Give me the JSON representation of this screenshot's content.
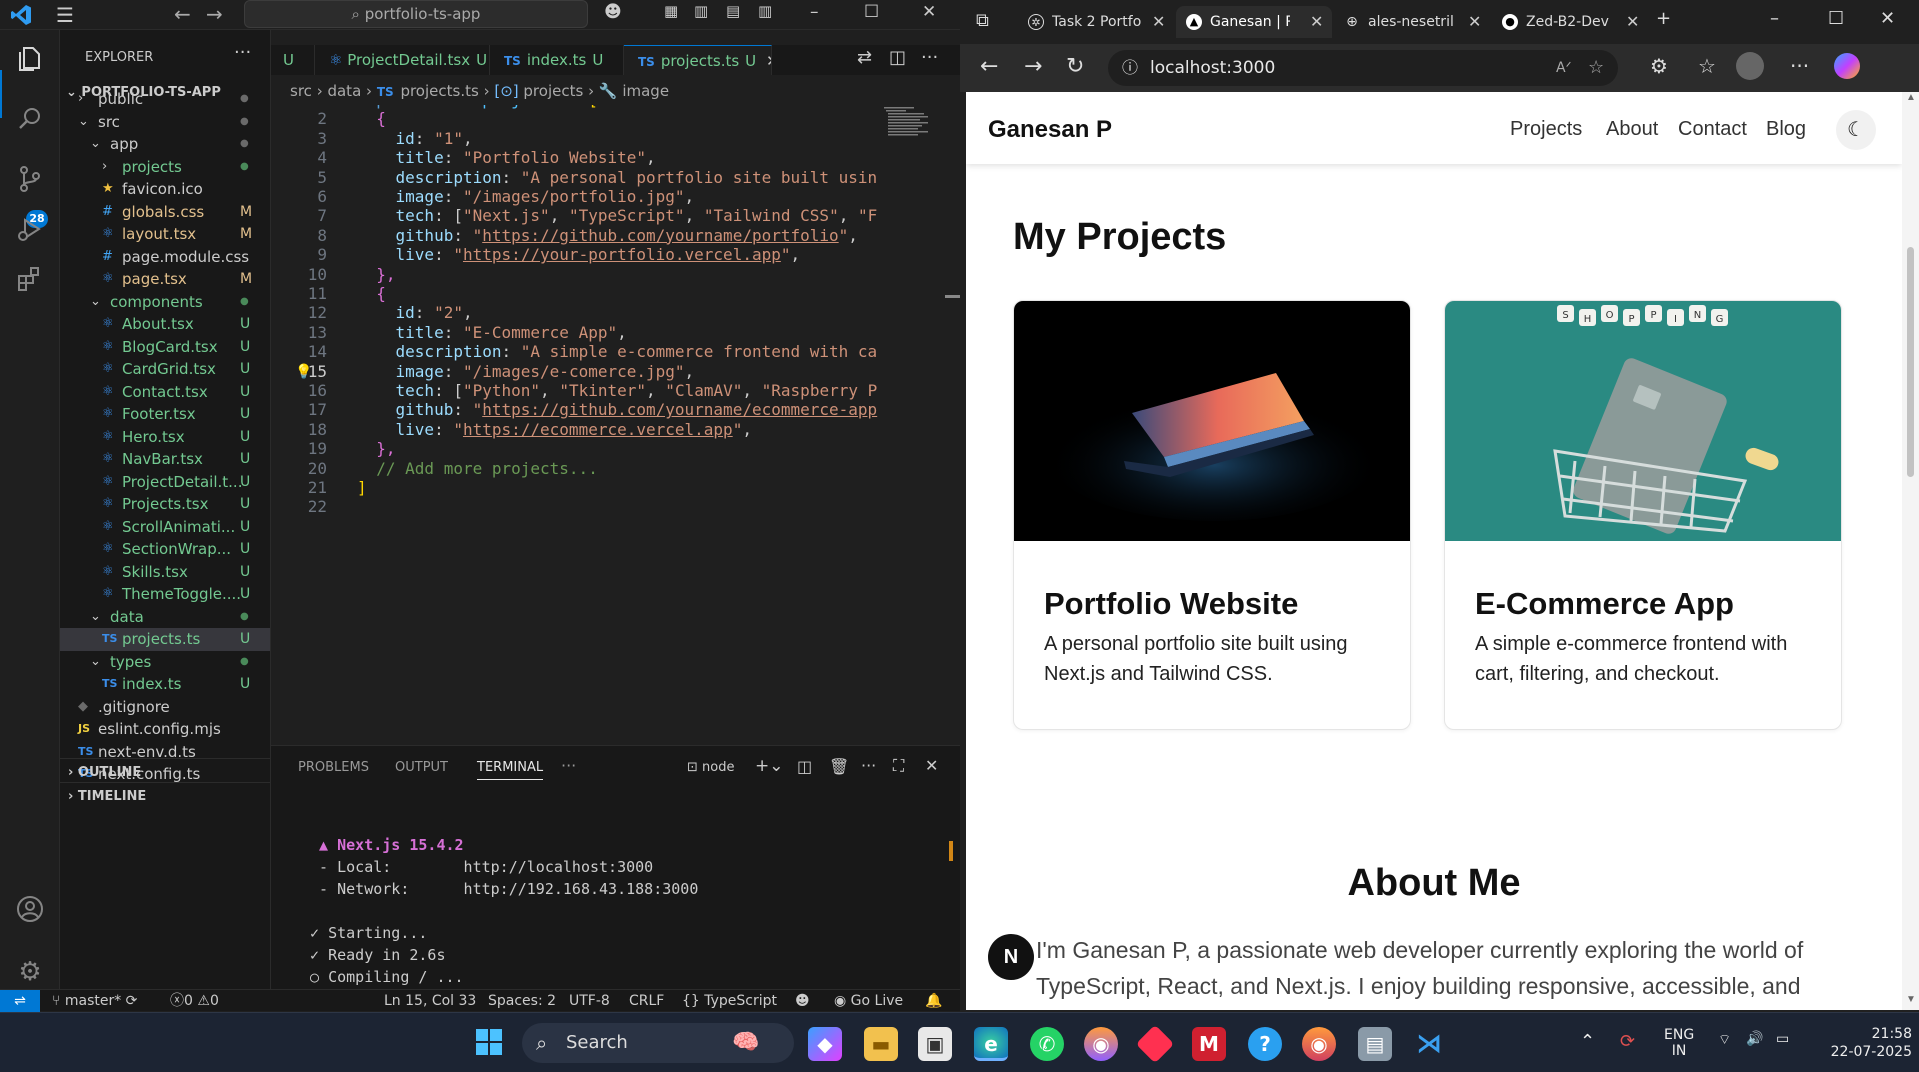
{
  "vscode": {
    "search_text": "portfolio-ts-app",
    "activity_badge": "28",
    "explorer": {
      "header": "EXPLORER",
      "project": "PORTFOLIO-TS-APP",
      "items": [
        {
          "name": "public",
          "depth": 1,
          "kind": "folder-closed",
          "status": "dot"
        },
        {
          "name": "src",
          "depth": 1,
          "kind": "folder-open",
          "status": "dot"
        },
        {
          "name": "app",
          "depth": 2,
          "kind": "folder-open",
          "status": "dot"
        },
        {
          "name": "projects",
          "depth": 3,
          "kind": "folder-closed",
          "status": "dot",
          "color": "untracked"
        },
        {
          "name": "favicon.ico",
          "depth": 3,
          "kind": "star",
          "status": ""
        },
        {
          "name": "globals.css",
          "depth": 3,
          "kind": "css",
          "status": "M",
          "color": "mod"
        },
        {
          "name": "layout.tsx",
          "depth": 3,
          "kind": "tsx",
          "status": "M",
          "color": "mod"
        },
        {
          "name": "page.module.css",
          "depth": 3,
          "kind": "css",
          "status": ""
        },
        {
          "name": "page.tsx",
          "depth": 3,
          "kind": "tsx",
          "status": "M",
          "color": "mod"
        },
        {
          "name": "components",
          "depth": 2,
          "kind": "folder-open",
          "status": "dot",
          "color": "untracked"
        },
        {
          "name": "About.tsx",
          "depth": 3,
          "kind": "tsx",
          "status": "U",
          "color": "untracked"
        },
        {
          "name": "BlogCard.tsx",
          "depth": 3,
          "kind": "tsx",
          "status": "U",
          "color": "untracked"
        },
        {
          "name": "CardGrid.tsx",
          "depth": 3,
          "kind": "tsx",
          "status": "U",
          "color": "untracked"
        },
        {
          "name": "Contact.tsx",
          "depth": 3,
          "kind": "tsx",
          "status": "U",
          "color": "untracked"
        },
        {
          "name": "Footer.tsx",
          "depth": 3,
          "kind": "tsx",
          "status": "U",
          "color": "untracked"
        },
        {
          "name": "Hero.tsx",
          "depth": 3,
          "kind": "tsx",
          "status": "U",
          "color": "untracked"
        },
        {
          "name": "NavBar.tsx",
          "depth": 3,
          "kind": "tsx",
          "status": "U",
          "color": "untracked"
        },
        {
          "name": "ProjectDetail.t...",
          "depth": 3,
          "kind": "tsx",
          "status": "U",
          "color": "untracked"
        },
        {
          "name": "Projects.tsx",
          "depth": 3,
          "kind": "tsx",
          "status": "U",
          "color": "untracked"
        },
        {
          "name": "ScrollAnimati...",
          "depth": 3,
          "kind": "tsx",
          "status": "U",
          "color": "untracked"
        },
        {
          "name": "SectionWrap...",
          "depth": 3,
          "kind": "tsx",
          "status": "U",
          "color": "untracked"
        },
        {
          "name": "Skills.tsx",
          "depth": 3,
          "kind": "tsx",
          "status": "U",
          "color": "untracked"
        },
        {
          "name": "ThemeToggle....",
          "depth": 3,
          "kind": "tsx",
          "status": "U",
          "color": "untracked"
        },
        {
          "name": "data",
          "depth": 2,
          "kind": "folder-open",
          "status": "dot",
          "color": "untracked"
        },
        {
          "name": "projects.ts",
          "depth": 3,
          "kind": "ts",
          "status": "U",
          "color": "untracked",
          "selected": true
        },
        {
          "name": "types",
          "depth": 2,
          "kind": "folder-open",
          "status": "dot",
          "color": "untracked"
        },
        {
          "name": "index.ts",
          "depth": 3,
          "kind": "ts",
          "status": "U",
          "color": "untracked"
        },
        {
          "name": ".gitignore",
          "depth": 1,
          "kind": "git",
          "status": ""
        },
        {
          "name": "eslint.config.mjs",
          "depth": 1,
          "kind": "js",
          "status": ""
        },
        {
          "name": "next-env.d.ts",
          "depth": 1,
          "kind": "ts",
          "status": ""
        },
        {
          "name": "next.config.ts",
          "depth": 1,
          "kind": "ts",
          "status": ""
        }
      ],
      "outline": "OUTLINE",
      "timeline": "TIMELINE"
    },
    "tabs": [
      {
        "name": "U",
        "status": ""
      },
      {
        "name": "ProjectDetail.tsx",
        "status": "U"
      },
      {
        "name": "index.ts",
        "status": "U"
      },
      {
        "name": "projects.ts",
        "status": "U"
      }
    ],
    "breadcrumb": [
      "src",
      "data",
      "projects.ts",
      "projects",
      "image"
    ],
    "code_lines": [
      "export const projects = [",
      "  {",
      "    id: \"1\",",
      "    title: \"Portfolio Website\",",
      "    description: \"A personal portfolio site built usin",
      "    image: \"/images/portfolio.jpg\",",
      "    tech: [\"Next.js\", \"TypeScript\", \"Tailwind CSS\", \"F",
      "    github: \"https://github.com/yourname/portfolio\",",
      "    live: \"https://your-portfolio.vercel.app\",",
      "  },",
      "  {",
      "    id: \"2\",",
      "    title: \"E-Commerce App\",",
      "    description: \"A simple e-commerce frontend with ca",
      "    image: \"/images/e-comerce.jpg\",",
      "    tech: [\"Python\", \"Tkinter\", \"ClamAV\", \"Raspberry P",
      "    github: \"https://github.com/yourname/ecommerce-app",
      "    live: \"https://ecommerce.vercel.app\",",
      "  },",
      "  // Add more projects...",
      "]",
      ""
    ],
    "current_line": 15,
    "panel": {
      "tabs": [
        "PROBLEMS",
        "OUTPUT",
        "TERMINAL"
      ],
      "shell": "node",
      "terminal_lines": [
        "  ▲ Next.js 15.4.2",
        "  - Local:        http://localhost:3000",
        "  - Network:      http://192.168.43.188:3000",
        "",
        " ✓ Starting...",
        " ✓ Ready in 2.6s",
        " ○ Compiling / ..."
      ]
    },
    "status": {
      "branch": "master*",
      "errors": "0",
      "warnings": "0",
      "cursor": "Ln 15, Col 33",
      "spaces": "Spaces: 2",
      "encoding": "UTF-8",
      "eol": "CRLF",
      "language": "TypeScript",
      "golive": "Go Live"
    }
  },
  "edge": {
    "tabs": [
      {
        "label": "Task 2 Portfo",
        "icon": "openai-icon"
      },
      {
        "label": "Ganesan | Po",
        "icon": "nextjs-icon",
        "active": true
      },
      {
        "label": "ales-nesetril",
        "icon": "globe-icon"
      },
      {
        "label": "Zed-B2-Dev",
        "icon": "github-icon"
      }
    ],
    "url": "localhost:3000",
    "site": {
      "brand": "Ganesan P",
      "nav": [
        "Projects",
        "About",
        "Contact",
        "Blog"
      ],
      "projects_title": "My Projects",
      "cards": [
        {
          "title": "Portfolio Website",
          "desc": "A personal portfolio site built using Next.js and Tailwind CSS."
        },
        {
          "title": "E-Commerce App",
          "desc": "A simple e-commerce frontend with cart, filtering, and checkout."
        }
      ],
      "shopping_letters": "SHOPPING",
      "about_title": "About Me",
      "about_text": "I'm Ganesan P, a passionate web developer currently exploring the world of TypeScript, React, and Next.js. I enjoy building responsive, accessible, and",
      "badge": "N"
    }
  },
  "taskbar": {
    "search": "Search",
    "lang1": "ENG",
    "lang2": "IN",
    "time": "21:58",
    "date": "22-07-2025"
  }
}
